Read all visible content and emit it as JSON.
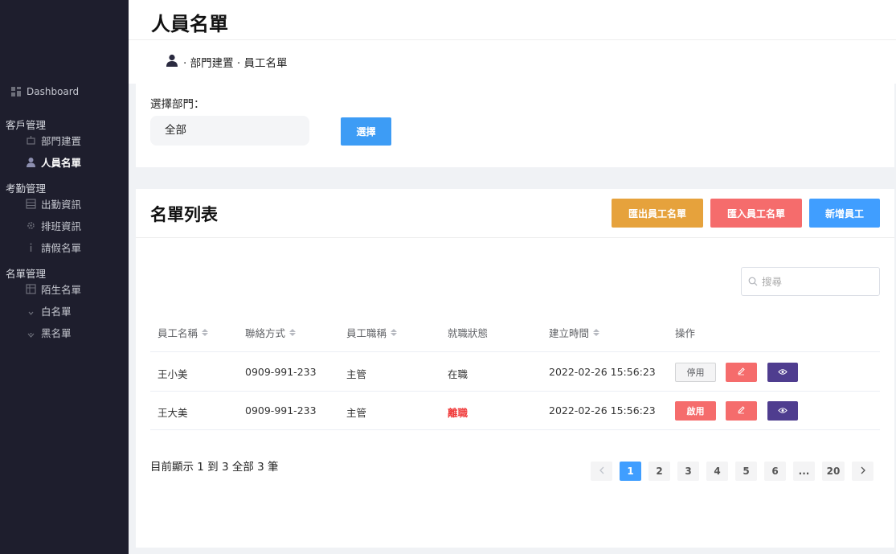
{
  "sidebar": {
    "dashboard": "Dashboard",
    "groups": [
      {
        "label": "客戶管理",
        "items": [
          {
            "label": "部門建置",
            "icon": "building-icon"
          },
          {
            "label": "人員名單",
            "icon": "user-icon",
            "active": true
          }
        ]
      },
      {
        "label": "考勤管理",
        "items": [
          {
            "label": "出勤資訊",
            "icon": "grid-icon"
          },
          {
            "label": "排班資訊",
            "icon": "gear-icon"
          },
          {
            "label": "請假名單",
            "icon": "info-icon"
          }
        ]
      },
      {
        "label": "名單管理",
        "items": [
          {
            "label": "陌生名單",
            "icon": "table-icon"
          },
          {
            "label": "白名單",
            "icon": "down-icon"
          },
          {
            "label": "黑名單",
            "icon": "shield-icon"
          }
        ]
      }
    ]
  },
  "header": {
    "title": "人員名單",
    "breadcrumb": "· 部門建置 · 員工名單"
  },
  "filter": {
    "label": "選擇部門：",
    "selected": "全部",
    "button": "選擇"
  },
  "list": {
    "title": "名單列表",
    "export_btn": "匯出員工名單",
    "import_btn": "匯入員工名單",
    "add_btn": "新增員工",
    "search_placeholder": "搜尋",
    "columns": [
      "員工名稱",
      "聯絡方式",
      "員工職稱",
      "就職狀態",
      "建立時間",
      "操作"
    ],
    "rows": [
      {
        "name": "王小美",
        "phone": "0909-991-233",
        "title": "主管",
        "status": "在職",
        "created": "2022-02-26 15:56:23",
        "toggle": "停用"
      },
      {
        "name": "王大美",
        "phone": "0909-991-233",
        "title": "主管",
        "status": "離職",
        "created": "2022-02-26 15:56:23",
        "toggle": "啟用"
      }
    ],
    "summary": "目前顯示 1 到 3 全部 3 筆",
    "pages": [
      "1",
      "2",
      "3",
      "4",
      "5",
      "6",
      "...",
      "20"
    ],
    "current_page": "1"
  },
  "colors": {
    "sidebar_bg": "#1e1e2d",
    "primary": "#409eff",
    "warning": "#e6a23c",
    "danger": "#f56c6c",
    "view": "#4f3d8f"
  }
}
